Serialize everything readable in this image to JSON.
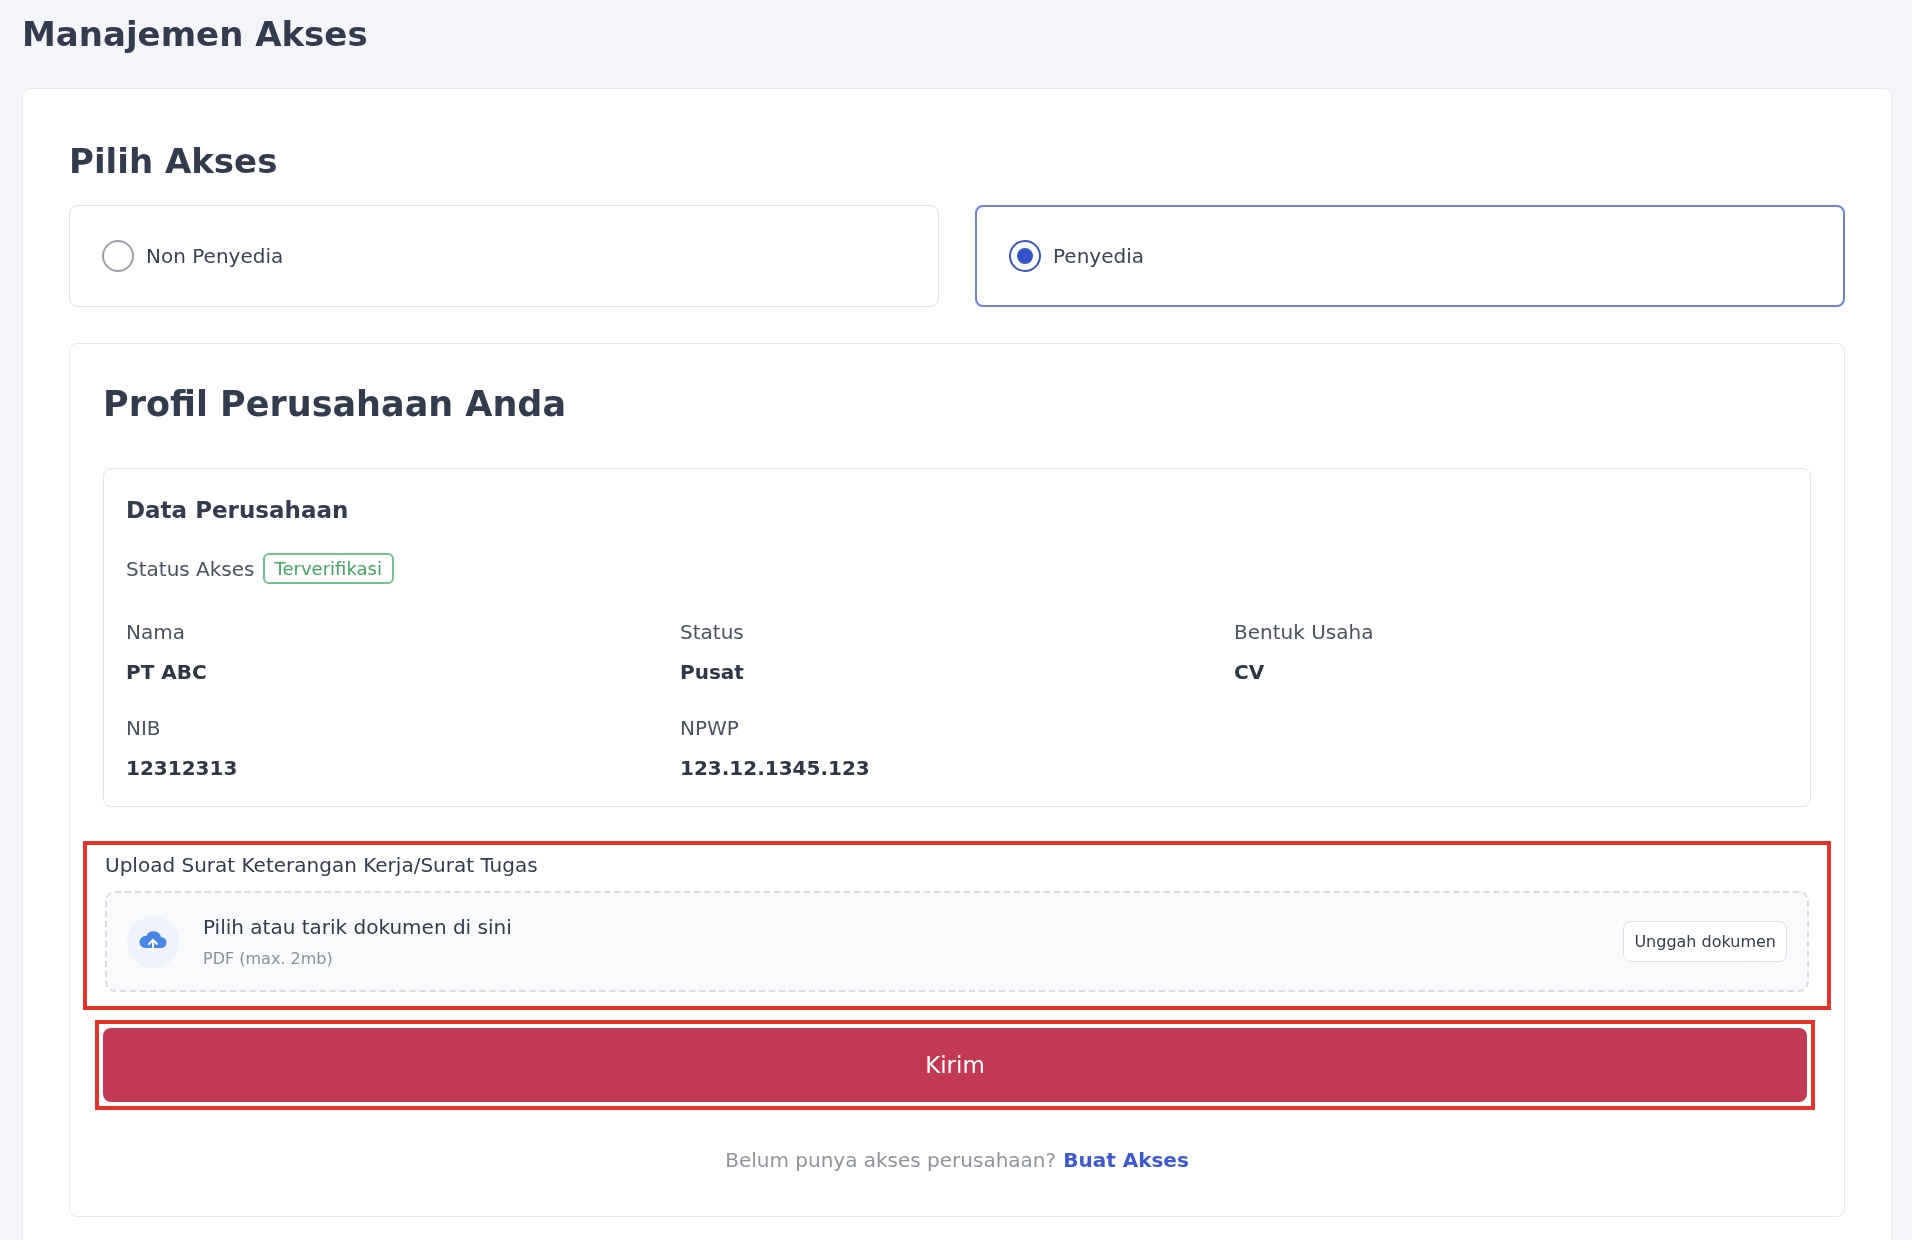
{
  "page_title": "Manajemen Akses",
  "access": {
    "title": "Pilih Akses",
    "options": [
      {
        "label": "Non Penyedia",
        "selected": false
      },
      {
        "label": "Penyedia",
        "selected": true
      }
    ]
  },
  "profile": {
    "title": "Profil Perusahaan Anda",
    "company": {
      "title": "Data Perusahaan",
      "status_label": "Status Akses",
      "status_badge": "Terverifikasi",
      "fields": [
        {
          "label": "Nama",
          "value": "PT ABC"
        },
        {
          "label": "Status",
          "value": "Pusat"
        },
        {
          "label": "Bentuk Usaha",
          "value": "CV"
        },
        {
          "label": "NIB",
          "value": "12312313"
        },
        {
          "label": "NPWP",
          "value": "123.12.1345.123"
        }
      ]
    },
    "upload": {
      "label": "Upload Surat Keterangan Kerja/Surat Tugas",
      "title": "Pilih atau tarik dokumen di sini",
      "hint": "PDF (max. 2mb)",
      "button": "Unggah dokumen",
      "highlighted": true
    },
    "submit": {
      "label": "Kirim",
      "highlighted": true
    },
    "footer": {
      "text": "Belum punya akses perusahaan?",
      "link": "Buat Akses"
    }
  }
}
